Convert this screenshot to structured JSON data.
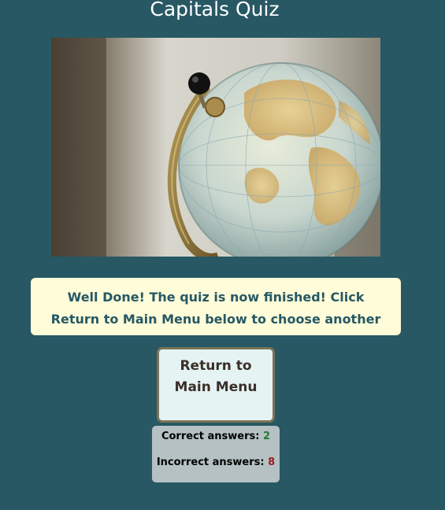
{
  "page": {
    "title": "Capitals Quiz"
  },
  "hero_image": {
    "alt": "Vintage globe on a brass stand"
  },
  "message": {
    "part1": "Well Done! The quiz is now finished! Click ",
    "link_text": "Return to Main Menu",
    "part2": " below to choose another quiz."
  },
  "actions": {
    "return_label": "Return to Main Menu"
  },
  "score": {
    "correct_label": "Correct answers: ",
    "correct_value": "2",
    "incorrect_label": "Incorrect answers: ",
    "incorrect_value": "8"
  },
  "colors": {
    "background": "#275864",
    "message_bg": "#fefcd9",
    "button_bg": "#e5f3f3",
    "score_bg": "#b5c1c3",
    "correct": "#1f7a2f",
    "incorrect": "#9b1c1c"
  }
}
